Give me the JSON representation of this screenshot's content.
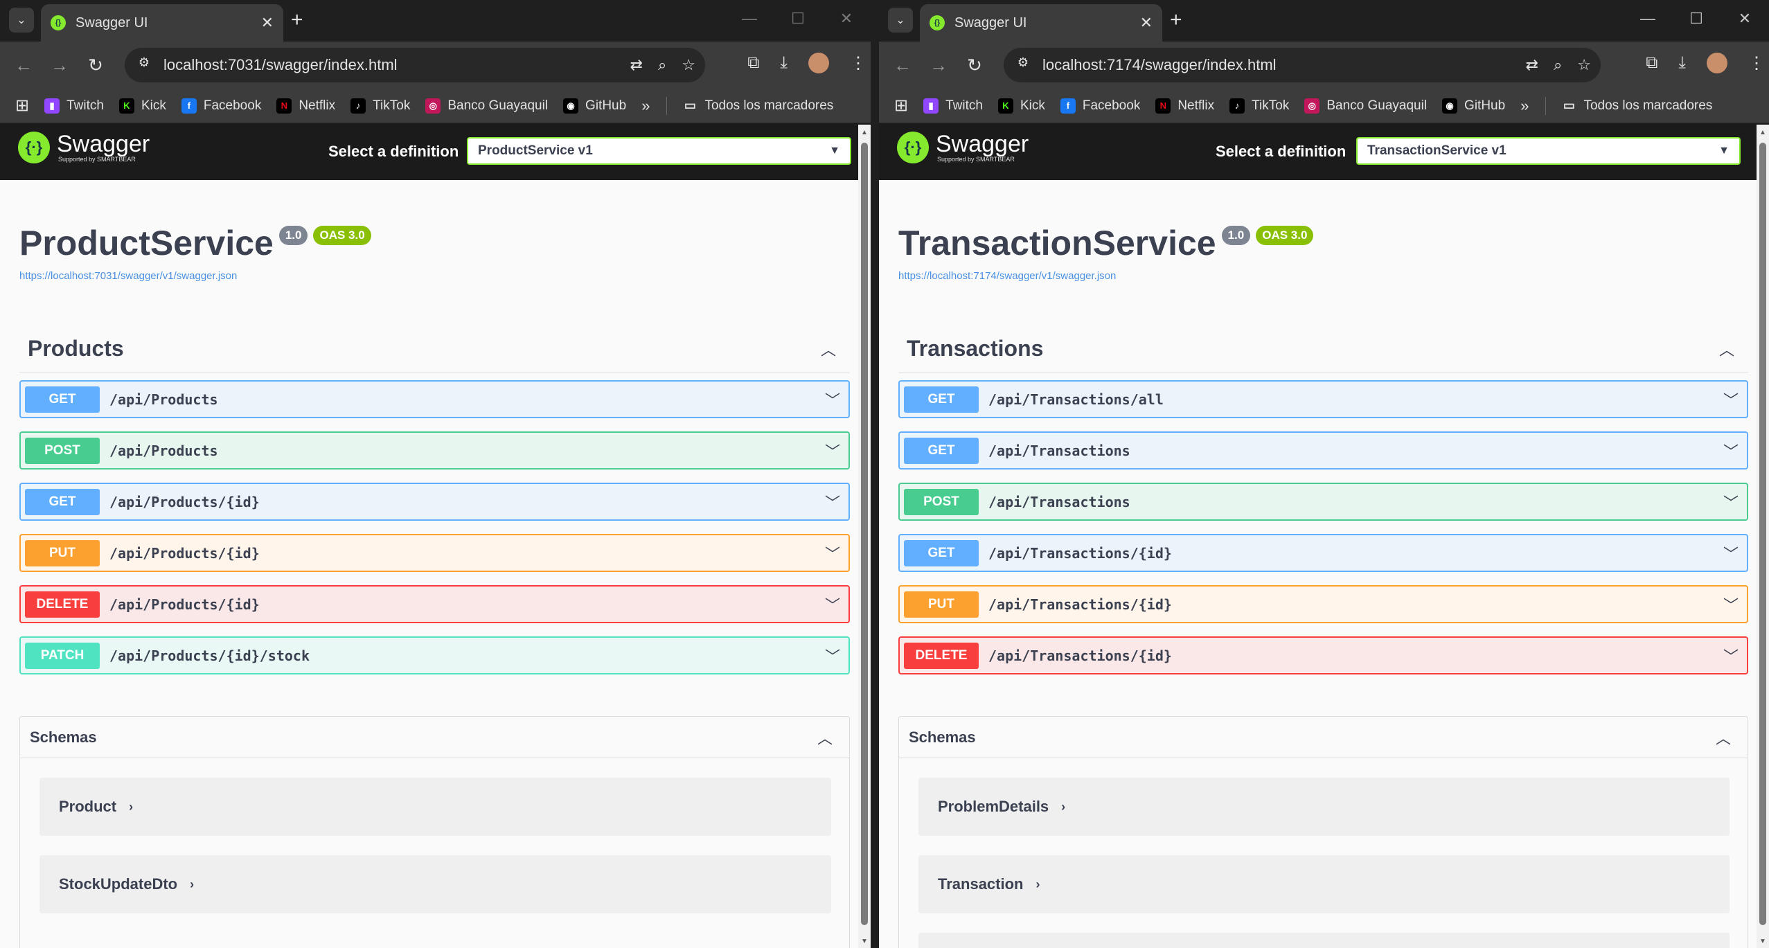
{
  "left": {
    "tab_title": "Swagger UI",
    "url": "localhost:7031/swagger/index.html",
    "bookmarks": [
      "Twitch",
      "Kick",
      "Facebook",
      "Netflix",
      "TikTok",
      "Banco Guayaquil",
      "GitHub"
    ],
    "all_bookmarks": "Todos los marcadores",
    "brand": "Swagger",
    "brand_sub": "Supported by SMARTBEAR",
    "select_label": "Select a definition",
    "selected_definition": "ProductService v1",
    "api_title": "ProductService",
    "version": "1.0",
    "oas": "OAS 3.0",
    "spec_url": "https://localhost:7031/swagger/v1/swagger.json",
    "tag": "Products",
    "operations": [
      {
        "method": "GET",
        "path": "/api/Products"
      },
      {
        "method": "POST",
        "path": "/api/Products"
      },
      {
        "method": "GET",
        "path": "/api/Products/{id}"
      },
      {
        "method": "PUT",
        "path": "/api/Products/{id}"
      },
      {
        "method": "DELETE",
        "path": "/api/Products/{id}"
      },
      {
        "method": "PATCH",
        "path": "/api/Products/{id}/stock"
      }
    ],
    "schemas_title": "Schemas",
    "schemas": [
      "Product",
      "StockUpdateDto"
    ]
  },
  "right": {
    "tab_title": "Swagger UI",
    "url": "localhost:7174/swagger/index.html",
    "bookmarks": [
      "Twitch",
      "Kick",
      "Facebook",
      "Netflix",
      "TikTok",
      "Banco Guayaquil",
      "GitHub"
    ],
    "all_bookmarks": "Todos los marcadores",
    "brand": "Swagger",
    "brand_sub": "Supported by SMARTBEAR",
    "select_label": "Select a definition",
    "selected_definition": "TransactionService v1",
    "api_title": "TransactionService",
    "version": "1.0",
    "oas": "OAS 3.0",
    "spec_url": "https://localhost:7174/swagger/v1/swagger.json",
    "tag": "Transactions",
    "operations": [
      {
        "method": "GET",
        "path": "/api/Transactions/all"
      },
      {
        "method": "GET",
        "path": "/api/Transactions"
      },
      {
        "method": "POST",
        "path": "/api/Transactions"
      },
      {
        "method": "GET",
        "path": "/api/Transactions/{id}"
      },
      {
        "method": "PUT",
        "path": "/api/Transactions/{id}"
      },
      {
        "method": "DELETE",
        "path": "/api/Transactions/{id}"
      }
    ],
    "schemas_title": "Schemas",
    "schemas": [
      "ProblemDetails",
      "Transaction"
    ]
  },
  "colors": {
    "get": "#61affe",
    "post": "#49cc90",
    "put": "#fca130",
    "delete": "#f93e3e",
    "patch": "#50e3c2",
    "swagger_green": "#85ea2d"
  },
  "icons": {
    "bookmarks": [
      "twitch-icon",
      "kick-icon",
      "facebook-icon",
      "netflix-icon",
      "tiktok-icon",
      "banco-icon",
      "github-icon"
    ]
  }
}
